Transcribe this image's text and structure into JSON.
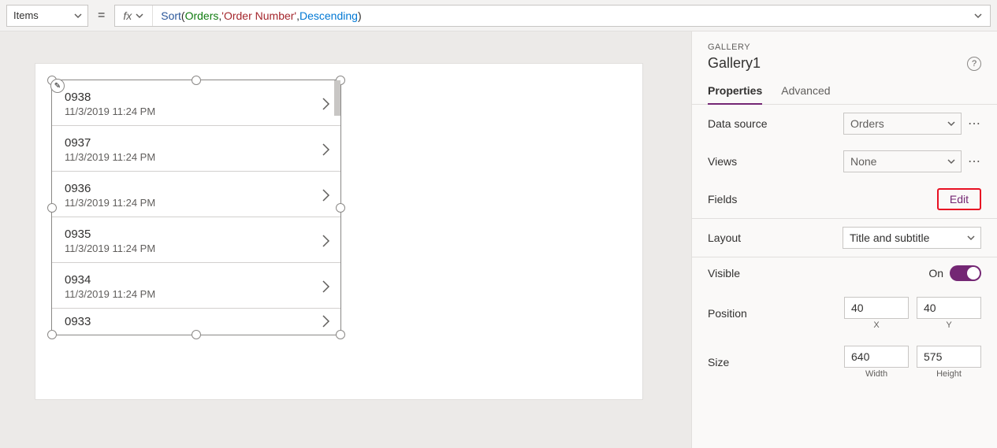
{
  "formula_bar": {
    "property": "Items",
    "fx_label": "fx",
    "tokens": {
      "fn": "Sort",
      "open": "( ",
      "ds": "Orders",
      "c1": ", ",
      "str": "'Order Number'",
      "c2": ", ",
      "enum": "Descending",
      "close": " )"
    }
  },
  "canvas": {
    "gallery_items": [
      {
        "title": "0938",
        "sub": "11/3/2019 11:24 PM"
      },
      {
        "title": "0937",
        "sub": "11/3/2019 11:24 PM"
      },
      {
        "title": "0936",
        "sub": "11/3/2019 11:24 PM"
      },
      {
        "title": "0935",
        "sub": "11/3/2019 11:24 PM"
      },
      {
        "title": "0934",
        "sub": "11/3/2019 11:24 PM"
      },
      {
        "title": "0933",
        "sub": ""
      }
    ]
  },
  "panel": {
    "type": "GALLERY",
    "name": "Gallery1",
    "tabs": {
      "properties": "Properties",
      "advanced": "Advanced"
    },
    "props": {
      "data_source_label": "Data source",
      "data_source_value": "Orders",
      "views_label": "Views",
      "views_value": "None",
      "fields_label": "Fields",
      "fields_edit": "Edit",
      "layout_label": "Layout",
      "layout_value": "Title and subtitle",
      "visible_label": "Visible",
      "visible_value": "On",
      "position_label": "Position",
      "position_x": "40",
      "position_y": "40",
      "position_x_cap": "X",
      "position_y_cap": "Y",
      "size_label": "Size",
      "size_w": "640",
      "size_h": "575",
      "size_w_cap": "Width",
      "size_h_cap": "Height"
    }
  },
  "glyphs": {
    "equals": "=",
    "pencil": "✎",
    "dots": "⋯"
  }
}
